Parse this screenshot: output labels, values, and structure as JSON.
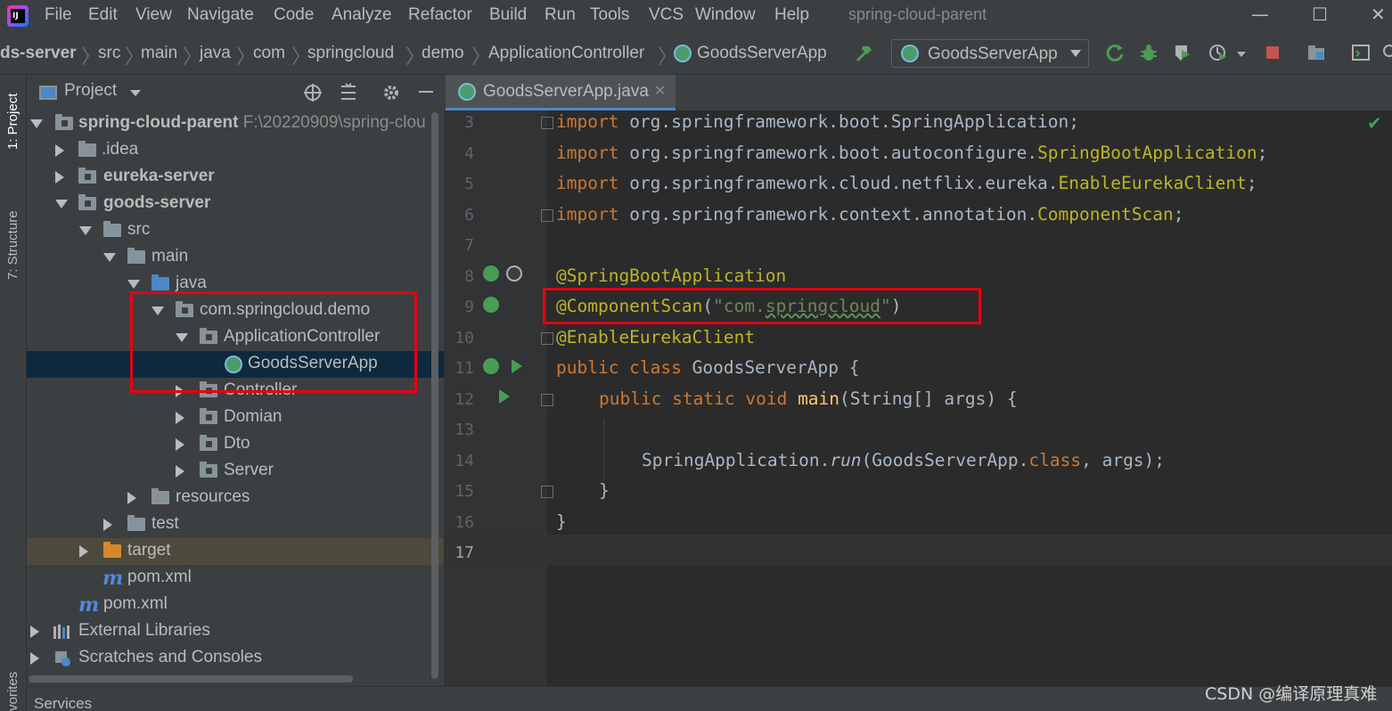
{
  "menu": {
    "items": [
      "File",
      "Edit",
      "View",
      "Navigate",
      "Code",
      "Analyze",
      "Refactor",
      "Build",
      "Run",
      "Tools",
      "VCS",
      "Window",
      "Help"
    ],
    "window_title": "spring-cloud-parent"
  },
  "breadcrumb": [
    "ds-server",
    "src",
    "main",
    "java",
    "com",
    "springcloud",
    "demo",
    "ApplicationController",
    "GoodsServerApp"
  ],
  "run_config": "GoodsServerApp",
  "left_tabs": {
    "project": "1: Project",
    "structure": "7: Structure",
    "favorites": "vorites"
  },
  "project_panel": {
    "title": "Project"
  },
  "tree": [
    {
      "label": "spring-cloud-parent",
      "path": "F:\\20220909\\spring-clou",
      "bold": true
    },
    {
      "label": ".idea"
    },
    {
      "label": "eureka-server",
      "bold": true
    },
    {
      "label": "goods-server",
      "bold": true
    },
    {
      "label": "src"
    },
    {
      "label": "main"
    },
    {
      "label": "java"
    },
    {
      "label": "com.springcloud.demo"
    },
    {
      "label": "ApplicationController"
    },
    {
      "label": "GoodsServerApp"
    },
    {
      "label": "Controller"
    },
    {
      "label": "Domian"
    },
    {
      "label": "Dto"
    },
    {
      "label": "Server"
    },
    {
      "label": "resources"
    },
    {
      "label": "test"
    },
    {
      "label": "target"
    },
    {
      "label": "pom.xml"
    },
    {
      "label": "pom.xml"
    },
    {
      "label": "External Libraries"
    },
    {
      "label": "Scratches and Consoles"
    }
  ],
  "editor": {
    "tab": "GoodsServerApp.java",
    "line_numbers": [
      "3",
      "4",
      "5",
      "6",
      "7",
      "8",
      "9",
      "10",
      "11",
      "12",
      "13",
      "14",
      "15",
      "16",
      "17"
    ],
    "code": {
      "l3": {
        "kw": "import",
        "a": " org.springframework.boot.SpringApplication;"
      },
      "l4": {
        "kw": "import",
        "a": " org.springframework.boot.autoconfigure.",
        "b": "SpringBootApplication",
        "c": ";"
      },
      "l5": {
        "kw": "import",
        "a": " org.springframework.cloud.netflix.eureka.",
        "b": "EnableEurekaClient",
        "c": ";"
      },
      "l6": {
        "kw": "import",
        "a": " org.springframework.context.annotation.",
        "b": "ComponentScan",
        "c": ";"
      },
      "l8": "@SpringBootApplication",
      "l9": {
        "ann": "@ComponentScan",
        "open": "(",
        "str1": "\"com.",
        "str2": "springcloud",
        "str3": "\"",
        "close": ")"
      },
      "l10": "@EnableEurekaClient",
      "l11": {
        "kw": "public class",
        "a": " GoodsServerApp {"
      },
      "l12": {
        "kw": "public static void",
        "fn": " main",
        "a": "(String[] args) {"
      },
      "l14": {
        "a": "SpringApplication.",
        "it": "run",
        "b": "(GoodsServerApp.",
        "kw": "class",
        "c": ", args);"
      },
      "l15": "}",
      "l16": "}"
    }
  },
  "bottom": {
    "services": "Services"
  },
  "watermark": "CSDN @编译原理真难",
  "colors": {
    "highlight_box": "#e60012",
    "keyword": "#cc7832",
    "annotation": "#bbb529",
    "string": "#6a8759"
  }
}
